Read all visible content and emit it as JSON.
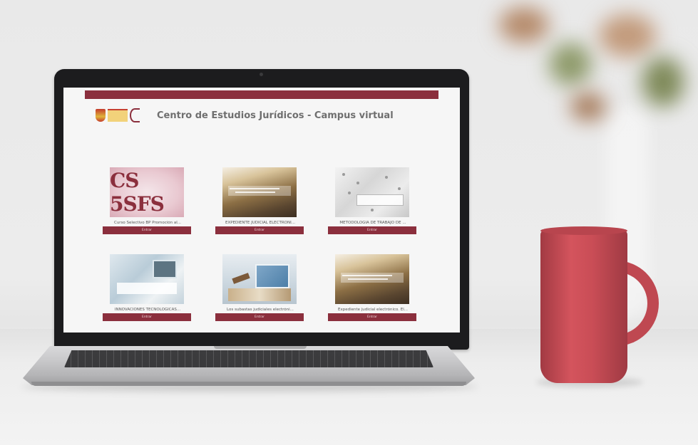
{
  "site": {
    "title": "Centro de Estudios Jurídicos - Campus virtual",
    "brand_color": "#8b2f3d"
  },
  "courses": [
    {
      "name": "Curso Selectivo BP Promoción al...",
      "button_label": "Entrar",
      "thumb_text": "CS 5SFS"
    },
    {
      "name": "EXPEDIENTE JUDICIAL ELECTRÓNI...",
      "button_label": "Entrar"
    },
    {
      "name": "METODOLOGÍA DE TRABAJO DE ...",
      "button_label": "Entrar"
    },
    {
      "name": "INNOVACIONES TECNOLÓGICAS...",
      "button_label": "Entrar"
    },
    {
      "name": "Los subastas judiciales electróni...",
      "button_label": "Entrar"
    },
    {
      "name": "Expediente judicial electrónico. El...",
      "button_label": "Entrar"
    }
  ],
  "icons": {
    "logo": "gobierno-de-espana-logo",
    "mug": "coffee-mug"
  }
}
